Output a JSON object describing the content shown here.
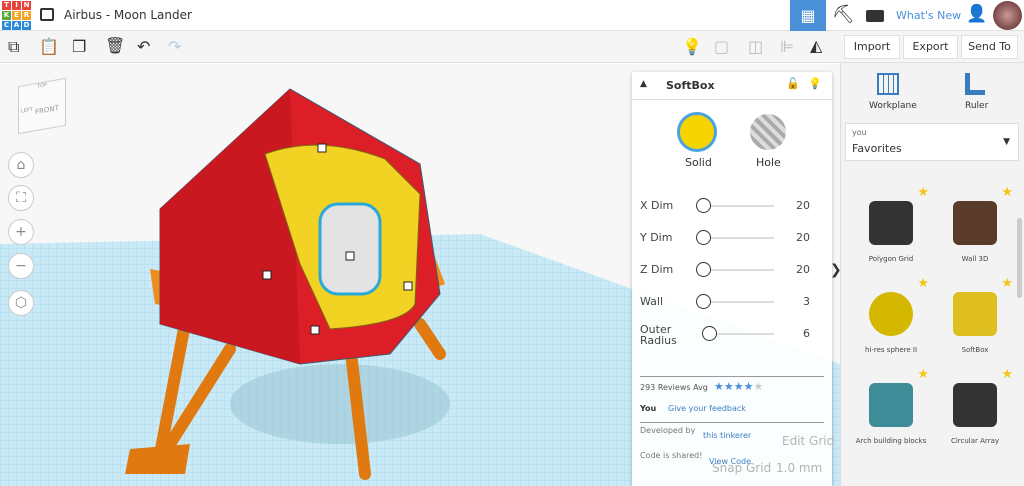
{
  "app": {
    "logo_letters": [
      "T",
      "I",
      "N",
      "K",
      "E",
      "R",
      "C",
      "A",
      "D"
    ],
    "logo_colors": [
      "#e8423b",
      "#e8423b",
      "#e8423b",
      "#5ea63b",
      "#f0a527",
      "#f0a527",
      "#2b8ad8",
      "#2b8ad8",
      "#2b8ad8"
    ],
    "title": "Airbus - Moon Lander"
  },
  "header": {
    "whats_new": "What's New",
    "accent": "#4a90d9"
  },
  "toolbar": {
    "import": "Import",
    "export": "Export",
    "send_to": "Send To"
  },
  "viewcube": {
    "top": "TOP",
    "left": "LEFT",
    "front": "FRONT"
  },
  "grid_controls": {
    "edit_grid": "Edit Grid",
    "snap_grid": "Snap Grid",
    "snap_value": "1.0 mm"
  },
  "inspector": {
    "shape_name": "SoftBox",
    "solid": "Solid",
    "hole": "Hole",
    "solid_color": "#f5d400",
    "params": [
      {
        "label": "X Dim",
        "value": "20",
        "level": 0
      },
      {
        "label": "Y Dim",
        "value": "20",
        "level": 0
      },
      {
        "label": "Z Dim",
        "value": "20",
        "level": 0
      },
      {
        "label": "Wall",
        "value": "3",
        "level": 0
      },
      {
        "label": "Outer Radius",
        "value": "6",
        "level": 0.1
      }
    ],
    "reviews": "293 Reviews Avg",
    "rating": 4,
    "rating_max": 5,
    "you": "You",
    "feedback": "Give your feedback",
    "developed_by": "Developed by",
    "developer": "this tinkerer",
    "code_shared": "Code is shared!",
    "view_code": "View Code"
  },
  "library": {
    "workplane": "Workplane",
    "ruler": "Ruler",
    "category_sub": "you",
    "category": "Favorites",
    "items": [
      {
        "label": "Polygon Grid"
      },
      {
        "label": "Wall 3D"
      },
      {
        "label": "hi-res sphere II"
      },
      {
        "label": "SoftBox"
      },
      {
        "label": "Arch building blocks"
      },
      {
        "label": "Circular Array"
      }
    ]
  }
}
